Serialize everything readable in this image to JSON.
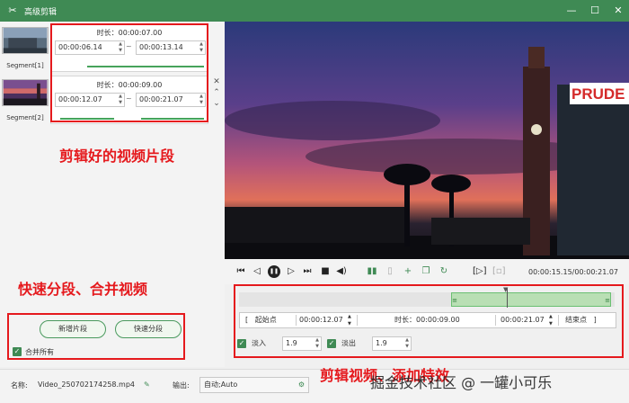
{
  "titlebar": {
    "app_icon": "scissors-icon",
    "title": "高级剪辑",
    "minimize": "—",
    "maximize": "☐",
    "close": "✕"
  },
  "segments": [
    {
      "label": "Segment[1]",
      "duration_label": "时长：",
      "duration": "00:00:07.00",
      "start": "00:00:06.14",
      "end": "00:00:13.14"
    },
    {
      "label": "Segment[2]",
      "duration_label": "时长：",
      "duration": "00:00:09.00",
      "start": "00:00:12.07",
      "end": "00:00:21.07"
    }
  ],
  "seg_separator": "~",
  "annotations": {
    "clips": "剪辑好的视频片段",
    "split_merge": "快速分段、合并视频",
    "cut_effects": "剪辑视频、添加特效"
  },
  "buttons": {
    "add_segment": "新增片段",
    "quick_split": "快速分段",
    "merge_all": "合并所有"
  },
  "player": {
    "time_readout": "00:00:15.15/00:00:21.07"
  },
  "range": {
    "start_label": "起始点",
    "start_value": "00:00:12.07",
    "duration_label": "时长：",
    "duration_value": "00:00:09.00",
    "end_value": "00:00:21.07",
    "end_label": "结束点"
  },
  "fade": {
    "fade_in_label": "淡入",
    "fade_in_value": "1.9",
    "fade_out_label": "淡出",
    "fade_out_value": "1.9"
  },
  "bottom": {
    "name_label": "名称:",
    "file_name": "Video_250702174258.mp4",
    "output_label": "输出:",
    "output_value": "自动;Auto"
  },
  "watermark": "掘金技术社区 @ 一罐小可乐",
  "colors": {
    "accent": "#3f8a54",
    "annotation_red": "#e5191d",
    "selection": "#b9dfb4"
  }
}
